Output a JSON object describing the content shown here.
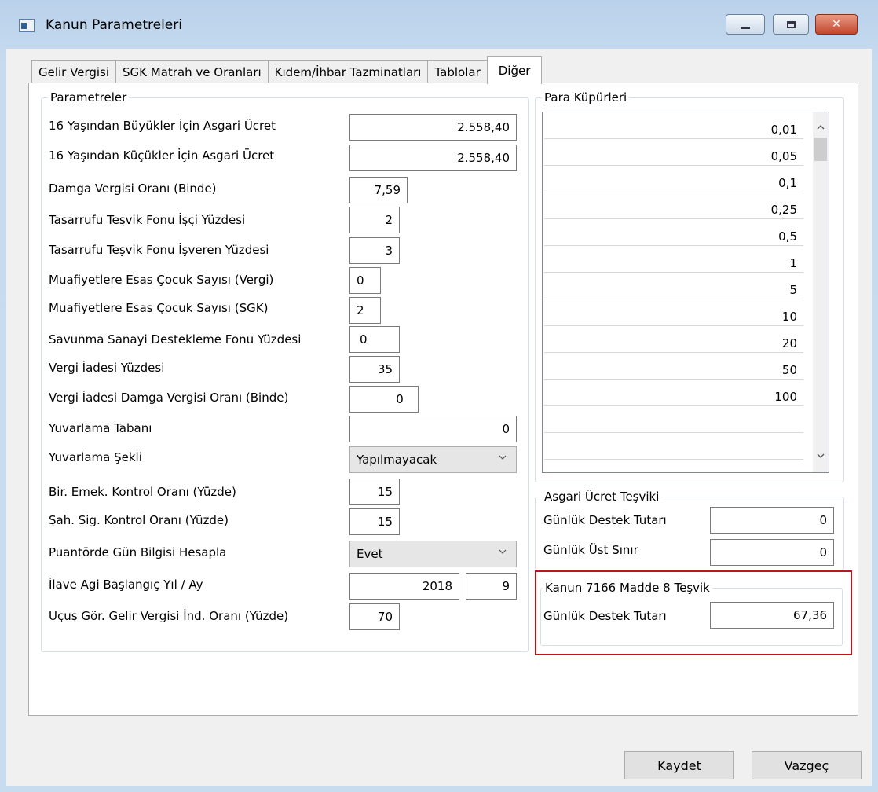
{
  "window": {
    "title": "Kanun Parametreleri"
  },
  "tabs": [
    {
      "label": "Gelir Vergisi"
    },
    {
      "label": "SGK Matrah ve Oranları"
    },
    {
      "label": "Kıdem/İhbar Tazminatları"
    },
    {
      "label": "Tablolar"
    },
    {
      "label": "Diğer",
      "active": true
    }
  ],
  "parametreler": {
    "title": "Parametreler",
    "rows": [
      {
        "label": "16 Yaşından Büyükler İçin Asgari Ücret",
        "value": "2.558,40"
      },
      {
        "label": "16 Yaşından Küçükler İçin Asgari Ücret",
        "value": "2.558,40"
      },
      {
        "label": "Damga Vergisi Oranı (Binde)",
        "value": "7,59"
      },
      {
        "label": "Tasarrufu Teşvik Fonu İşçi Yüzdesi",
        "value": "2"
      },
      {
        "label": "Tasarrufu Teşvik Fonu İşveren Yüzdesi",
        "value": "3"
      },
      {
        "label": "Muafiyetlere Esas Çocuk Sayısı (Vergi)",
        "value": "0"
      },
      {
        "label": "Muafiyetlere Esas Çocuk Sayısı (SGK)",
        "value": "2"
      },
      {
        "label": "Savunma Sanayi Destekleme Fonu Yüzdesi",
        "value": "0"
      },
      {
        "label": "Vergi İadesi Yüzdesi",
        "value": "35"
      },
      {
        "label": "Vergi İadesi Damga Vergisi Oranı (Binde)",
        "value": "0"
      },
      {
        "label": "Yuvarlama Tabanı",
        "value": "0"
      },
      {
        "label": "Yuvarlama Şekli",
        "value": "Yapılmayacak"
      },
      {
        "label": "Bir. Emek. Kontrol Oranı (Yüzde)",
        "value": "15"
      },
      {
        "label": "Şah. Sig. Kontrol Oranı (Yüzde)",
        "value": "15"
      },
      {
        "label": "Puantörde Gün Bilgisi Hesapla",
        "value": "Evet"
      },
      {
        "label": "İlave Agi Başlangıç Yıl / Ay",
        "value": "2018",
        "value2": "9"
      },
      {
        "label": "Uçuş Gör. Gelir Vergisi İnd. Oranı (Yüzde)",
        "value": "70"
      }
    ]
  },
  "para_kupurleri": {
    "title": "Para Küpürleri",
    "values": [
      "0,01",
      "0,05",
      "0,1",
      "0,25",
      "0,5",
      "1",
      "5",
      "10",
      "20",
      "50",
      "100",
      "",
      ""
    ]
  },
  "asgari_ucret_tesviki": {
    "title": "Asgari Ücret Teşviki",
    "gunluk_destek_label": "Günlük Destek Tutarı",
    "gunluk_destek_value": "0",
    "gunluk_ust_label": "Günlük Üst Sınır",
    "gunluk_ust_value": "0"
  },
  "kanun_7166": {
    "title": "Kanun 7166 Madde 8 Teşvik",
    "gunluk_destek_label": "Günlük Destek Tutarı",
    "gunluk_destek_value": "67,36"
  },
  "buttons": {
    "save": "Kaydet",
    "cancel": "Vazgeç"
  },
  "colors": {
    "highlight": "#c0141b",
    "title_bar": "#b9d1ea",
    "close_button": "#c4452b"
  }
}
